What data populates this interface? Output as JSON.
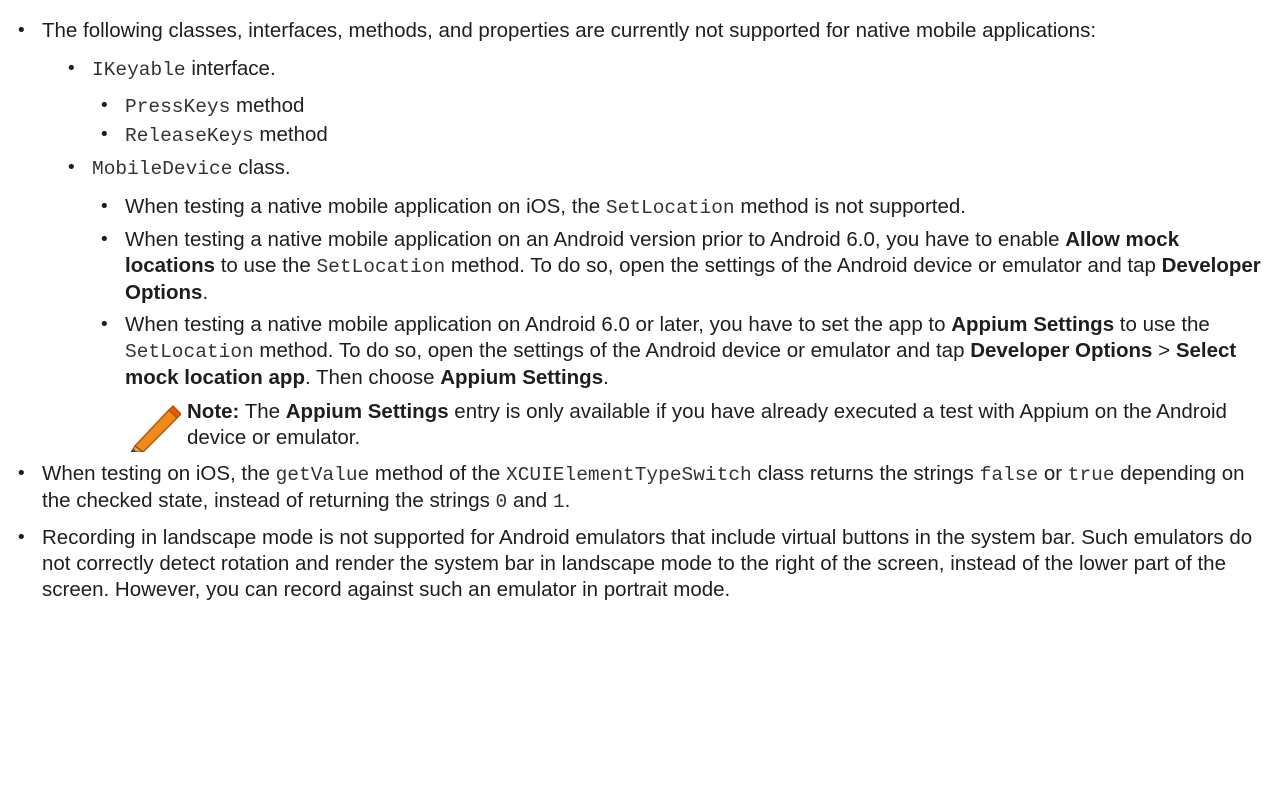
{
  "items": {
    "i1": {
      "text": "The following classes, interfaces, methods, and properties are currently not supported for native mobile applications:",
      "ikeyable": {
        "code": "IKeyable",
        "suffix": " interface."
      },
      "presskeys": {
        "code": "PressKeys",
        "suffix": " method"
      },
      "releasekeys": {
        "code": "ReleaseKeys",
        "suffix": " method"
      },
      "mobiledevice": {
        "code": "MobileDevice",
        "suffix": " class."
      },
      "md1": {
        "a": "When testing a native mobile application on iOS, the ",
        "code": "SetLocation",
        "b": " method is not supported."
      },
      "md2": {
        "a": "When testing a native mobile application on an Android version prior to Android 6.0, you have to enable ",
        "bold1": "Allow mock locations",
        "b": " to use the ",
        "code": "SetLocation",
        "c": " method. To do so, open the settings of the Android device or emulator and tap ",
        "bold2": "Developer Options",
        "d": "."
      },
      "md3": {
        "a": "When testing a native mobile application on Android 6.0 or later, you have to set the app to ",
        "bold1": "Appium Settings",
        "b": " to use the ",
        "code": "SetLocation",
        "c": " method. To do so, open the settings of the Android device or emulator and tap ",
        "bold2": "Developer Options",
        "d": " > ",
        "bold3": "Select mock location app",
        "e": ". Then choose ",
        "bold4": "Appium Settings",
        "f": "."
      },
      "note": {
        "label": "Note:",
        "a": " The ",
        "bold": "Appium Settings",
        "b": " entry is only available if you have already executed a test with Appium on the Android device or emulator."
      }
    },
    "i2": {
      "a": "When testing on iOS, the ",
      "code1": "getValue",
      "b": " method of the ",
      "code2": "XCUIElementTypeSwitch",
      "c": " class returns the strings ",
      "code3": "false",
      "d": " or ",
      "code4": "true",
      "e": " depending on the checked state, instead of returning the strings ",
      "code5": "0",
      "f": " and ",
      "code6": "1",
      "g": "."
    },
    "i3": {
      "text": "Recording in landscape mode is not supported for Android emulators that include virtual buttons in the system bar. Such emulators do not correctly detect rotation and render the system bar in landscape mode to the right of the screen, instead of the lower part of the screen. However, you can record against such an emulator in portrait mode."
    }
  },
  "icons": {
    "note": "pencil-icon"
  },
  "colors": {
    "text": "#1e1e1e",
    "code": "#333333",
    "pencil_orange": "#f08a1c",
    "pencil_tip": "#a0522d"
  }
}
